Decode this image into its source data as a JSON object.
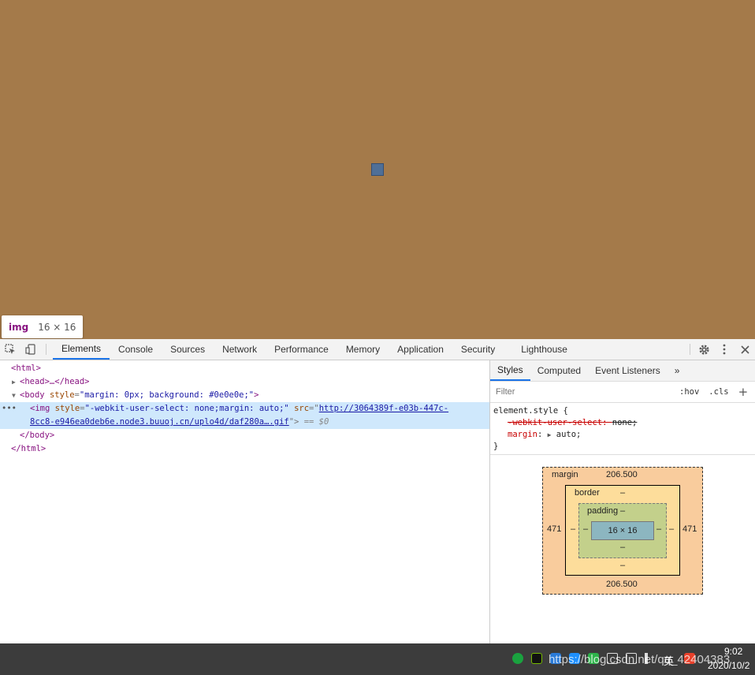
{
  "tooltip": {
    "tag": "img",
    "dims": "16 × 16"
  },
  "toolbar": {
    "tabs": [
      "Elements",
      "Console",
      "Sources",
      "Network",
      "Performance",
      "Memory",
      "Application",
      "Security",
      "Lighthouse"
    ],
    "active_tab": "Elements"
  },
  "dom": {
    "html_open": "<html>",
    "head": "<head>…</head>",
    "body_open_tag": "<body",
    "body_attr": "style",
    "body_val": "\"margin: 0px; background: #0e0e0e;\"",
    "img_open": "<img",
    "img_attr_style": "style",
    "img_style_val": "\"-webkit-user-select: none;margin: auto;\"",
    "img_attr_src": "src",
    "img_src_line1": "http://3064389f-e03b-447c-",
    "img_src_line2": "8cc8-e946ea0deb6e.node3.buuoj.cn/uplo4d/daf280a….gif",
    "img_close": "\">",
    "dollar": "== $0",
    "body_close": "</body>",
    "html_close": "</html>"
  },
  "sidebar": {
    "tabs": [
      "Styles",
      "Computed",
      "Event Listeners"
    ],
    "active_tab": "Styles",
    "more": "»",
    "filter_placeholder": "Filter",
    "hov": ":hov",
    "cls": ".cls",
    "plus": "+",
    "rule_selector": "element.style {",
    "rule_close": "}",
    "props": [
      {
        "name": "-webkit-user-select",
        "value": "none;",
        "struck": true
      },
      {
        "name": "margin",
        "value": "auto;",
        "struck": false
      }
    ]
  },
  "box_model": {
    "margin_label": "margin",
    "margin_top": "206.500",
    "margin_bottom": "206.500",
    "margin_left": "471",
    "margin_right": "471",
    "border_label": "border",
    "border_value": "–",
    "padding_label": "padding",
    "padding_value": "–",
    "content": "16 × 16"
  },
  "taskbar": {
    "time": "9:02",
    "date": "2020/10/2",
    "lang": "英",
    "watermark": "https://blog.csdn.net/qq_42404383"
  },
  "colors": {
    "page_background": "#a47a4a",
    "accent": "#1a73e8",
    "tag_color": "#881280"
  }
}
